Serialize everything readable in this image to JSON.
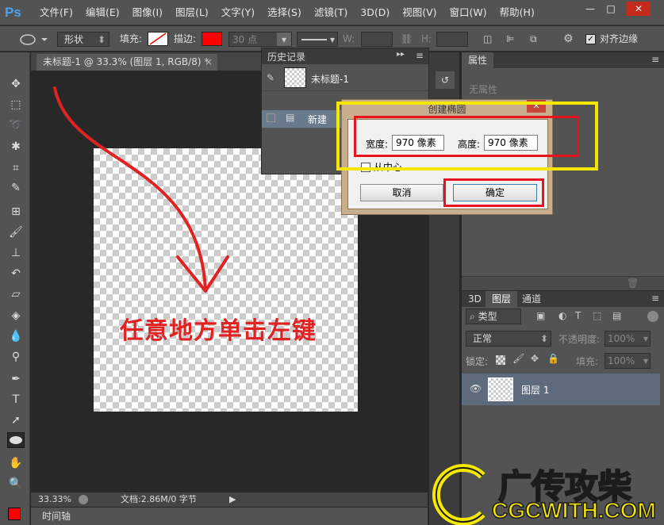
{
  "app": {
    "logo": "Ps"
  },
  "menu": [
    "文件(F)",
    "编辑(E)",
    "图像(I)",
    "图层(L)",
    "文字(Y)",
    "选择(S)",
    "滤镜(T)",
    "3D(D)",
    "视图(V)",
    "窗口(W)",
    "帮助(H)"
  ],
  "window_controls": {
    "minimize": "—",
    "maximize": "□",
    "close": "✕"
  },
  "options": {
    "mode": "形状",
    "fill_label": "填充:",
    "stroke_label": "描边:",
    "stroke_size": "30 点",
    "w_label": "W:",
    "h_label": "H:",
    "align_edges": "对齐边缘"
  },
  "document": {
    "tab_title": "未标题-1 @ 33.3% (图层 1, RGB/8) *",
    "zoom": "33.33%",
    "doc_info": "文档:2.86M/0 字节",
    "timeline": "时间轴"
  },
  "history": {
    "title": "历史记录",
    "snapshot": "未标题-1",
    "items": [
      "新建"
    ]
  },
  "properties": {
    "tab": "属性",
    "content": "无属性"
  },
  "layers": {
    "tabs": [
      "3D",
      "图层",
      "通道"
    ],
    "filter": "类型",
    "blend_mode": "正常",
    "opacity_label": "不透明度:",
    "opacity": "100%",
    "lock_label": "锁定:",
    "fill_label": "填充:",
    "fill": "100%",
    "layer_name": "图层 1"
  },
  "dialog": {
    "title": "创建椭圆",
    "width_label": "宽度:",
    "width_value": "970 像素",
    "height_label": "高度:",
    "height_value": "970 像素",
    "from_center": "从中心",
    "cancel": "取消",
    "ok": "确定"
  },
  "annotation": "任意地方单击左键",
  "watermark": {
    "cn": "广传攻柴",
    "en": "CGCWITH.COM"
  },
  "colors": {
    "foreground": "#ff0000",
    "background": "#ffffff",
    "annotation": "#e02222",
    "highlight_yellow": "#f5e800"
  }
}
